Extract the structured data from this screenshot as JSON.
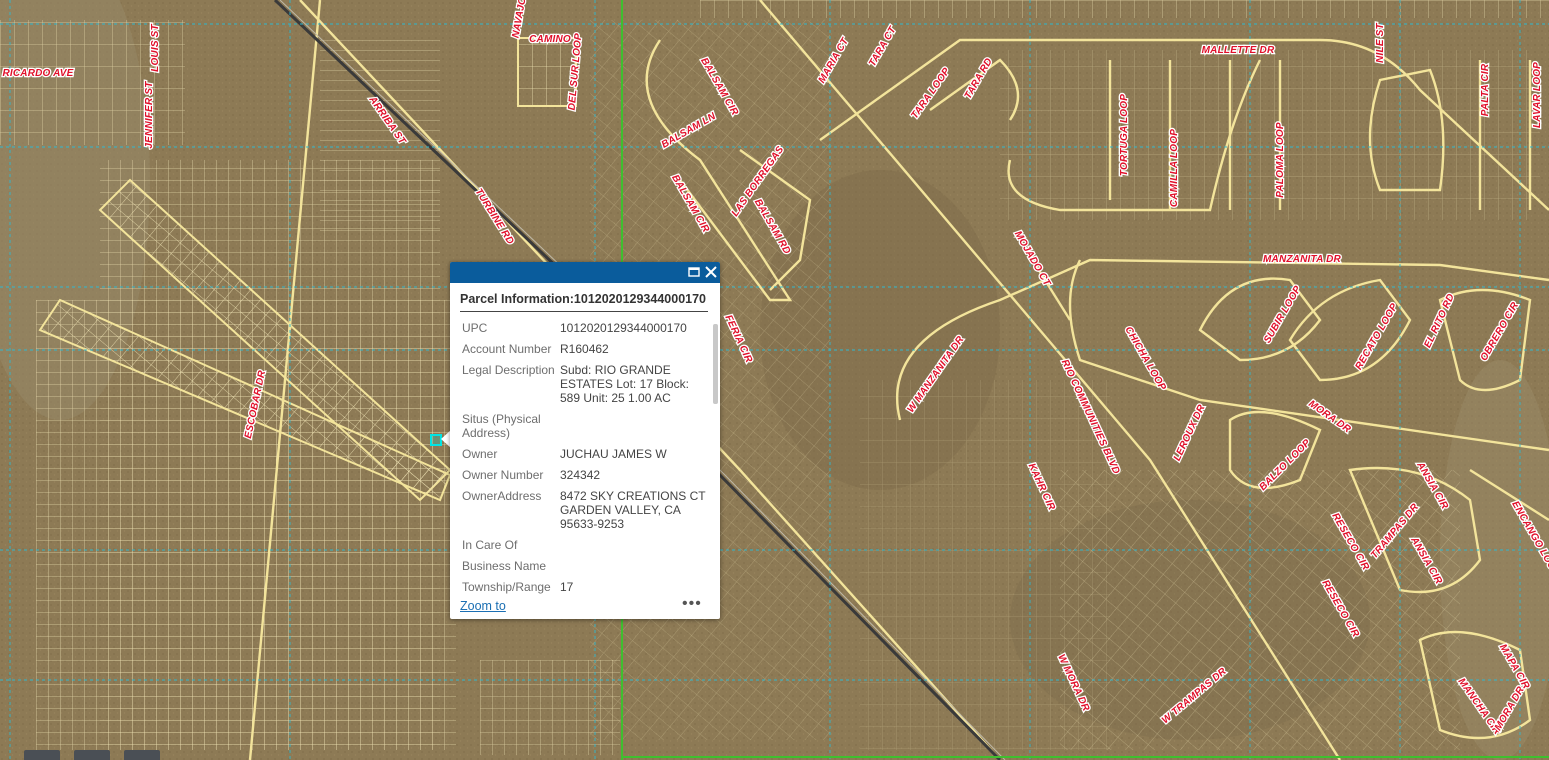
{
  "map": {
    "colors": {
      "terrain": "#8d7a55",
      "parcel_line": "#efe3b4",
      "road_line": "#f3e49b",
      "grid_line": "#2fb8d0",
      "label_fill": "#e0102a",
      "boundary": "#3fbf2f"
    },
    "street_labels": [
      "RICARDO AVE",
      "LOUIS ST",
      "JENNIFER ST",
      "ARRIBA ST",
      "TURBINE RD",
      "ESCOBAR DR",
      "NAVAJO",
      "CAMINO",
      "DEL SUR LOOP",
      "BALSAM CIR",
      "BALSAM LN",
      "BALSAM CIR",
      "LAS BORREGAS",
      "BALSAM RD",
      "MARIA CT",
      "TARA CT",
      "TARA LOOP",
      "TARA RD",
      "MALLETTE DR",
      "TORTUGA LOOP",
      "CAMILLA LOOP",
      "PALOMA LOOP",
      "NILE ST",
      "PALTA CIR",
      "LAVAR LOOP",
      "MOJADO CT",
      "MANZANITA DR",
      "SUBIR LOOP",
      "RECATO LOOP",
      "EL RITO RD",
      "OBRERO CIR",
      "W MANZANITA DR",
      "CHICHA LOOP",
      "RIO COMMUNITIES BLVD",
      "LEROUX DR",
      "MORA DR",
      "BALZO LOOP",
      "ANSIA CIR",
      "ENCANGO LOOP",
      "KAHR CIR",
      "RESECO CIR",
      "TRAMPAS DR",
      "ANSIA CIR",
      "RESECO CIR",
      "W MORA DR",
      "W TRAMPAS DR",
      "MAPA CIR",
      "MANCHA CIR",
      "MORA DR",
      "FERIA CIR"
    ]
  },
  "popup": {
    "title": "Parcel Information:1012020129344000170",
    "attributes": [
      {
        "label": "UPC",
        "value": "1012020129344000170"
      },
      {
        "label": "Account Number",
        "value": "R160462"
      },
      {
        "label": "Legal Description",
        "value": "Subd: RIO GRANDE ESTATES Lot: 17 Block: 589 Unit: 25 1.00 AC"
      },
      {
        "label": "Situs (Physical Address)",
        "value": ""
      },
      {
        "label": "Owner",
        "value": "JUCHAU JAMES W"
      },
      {
        "label": "Owner Number",
        "value": "324342"
      },
      {
        "label": "OwnerAddress",
        "value": "8472 SKY CREATIONS CT GARDEN VALLEY, CA 95633-9253"
      },
      {
        "label": "In Care Of",
        "value": ""
      },
      {
        "label": "Business Name",
        "value": ""
      },
      {
        "label": "Township/Range",
        "value": "17"
      }
    ],
    "zoom_label": "Zoom to",
    "more_label": "•••",
    "maximize_icon": "maximize-icon",
    "close_icon": "close-icon"
  }
}
